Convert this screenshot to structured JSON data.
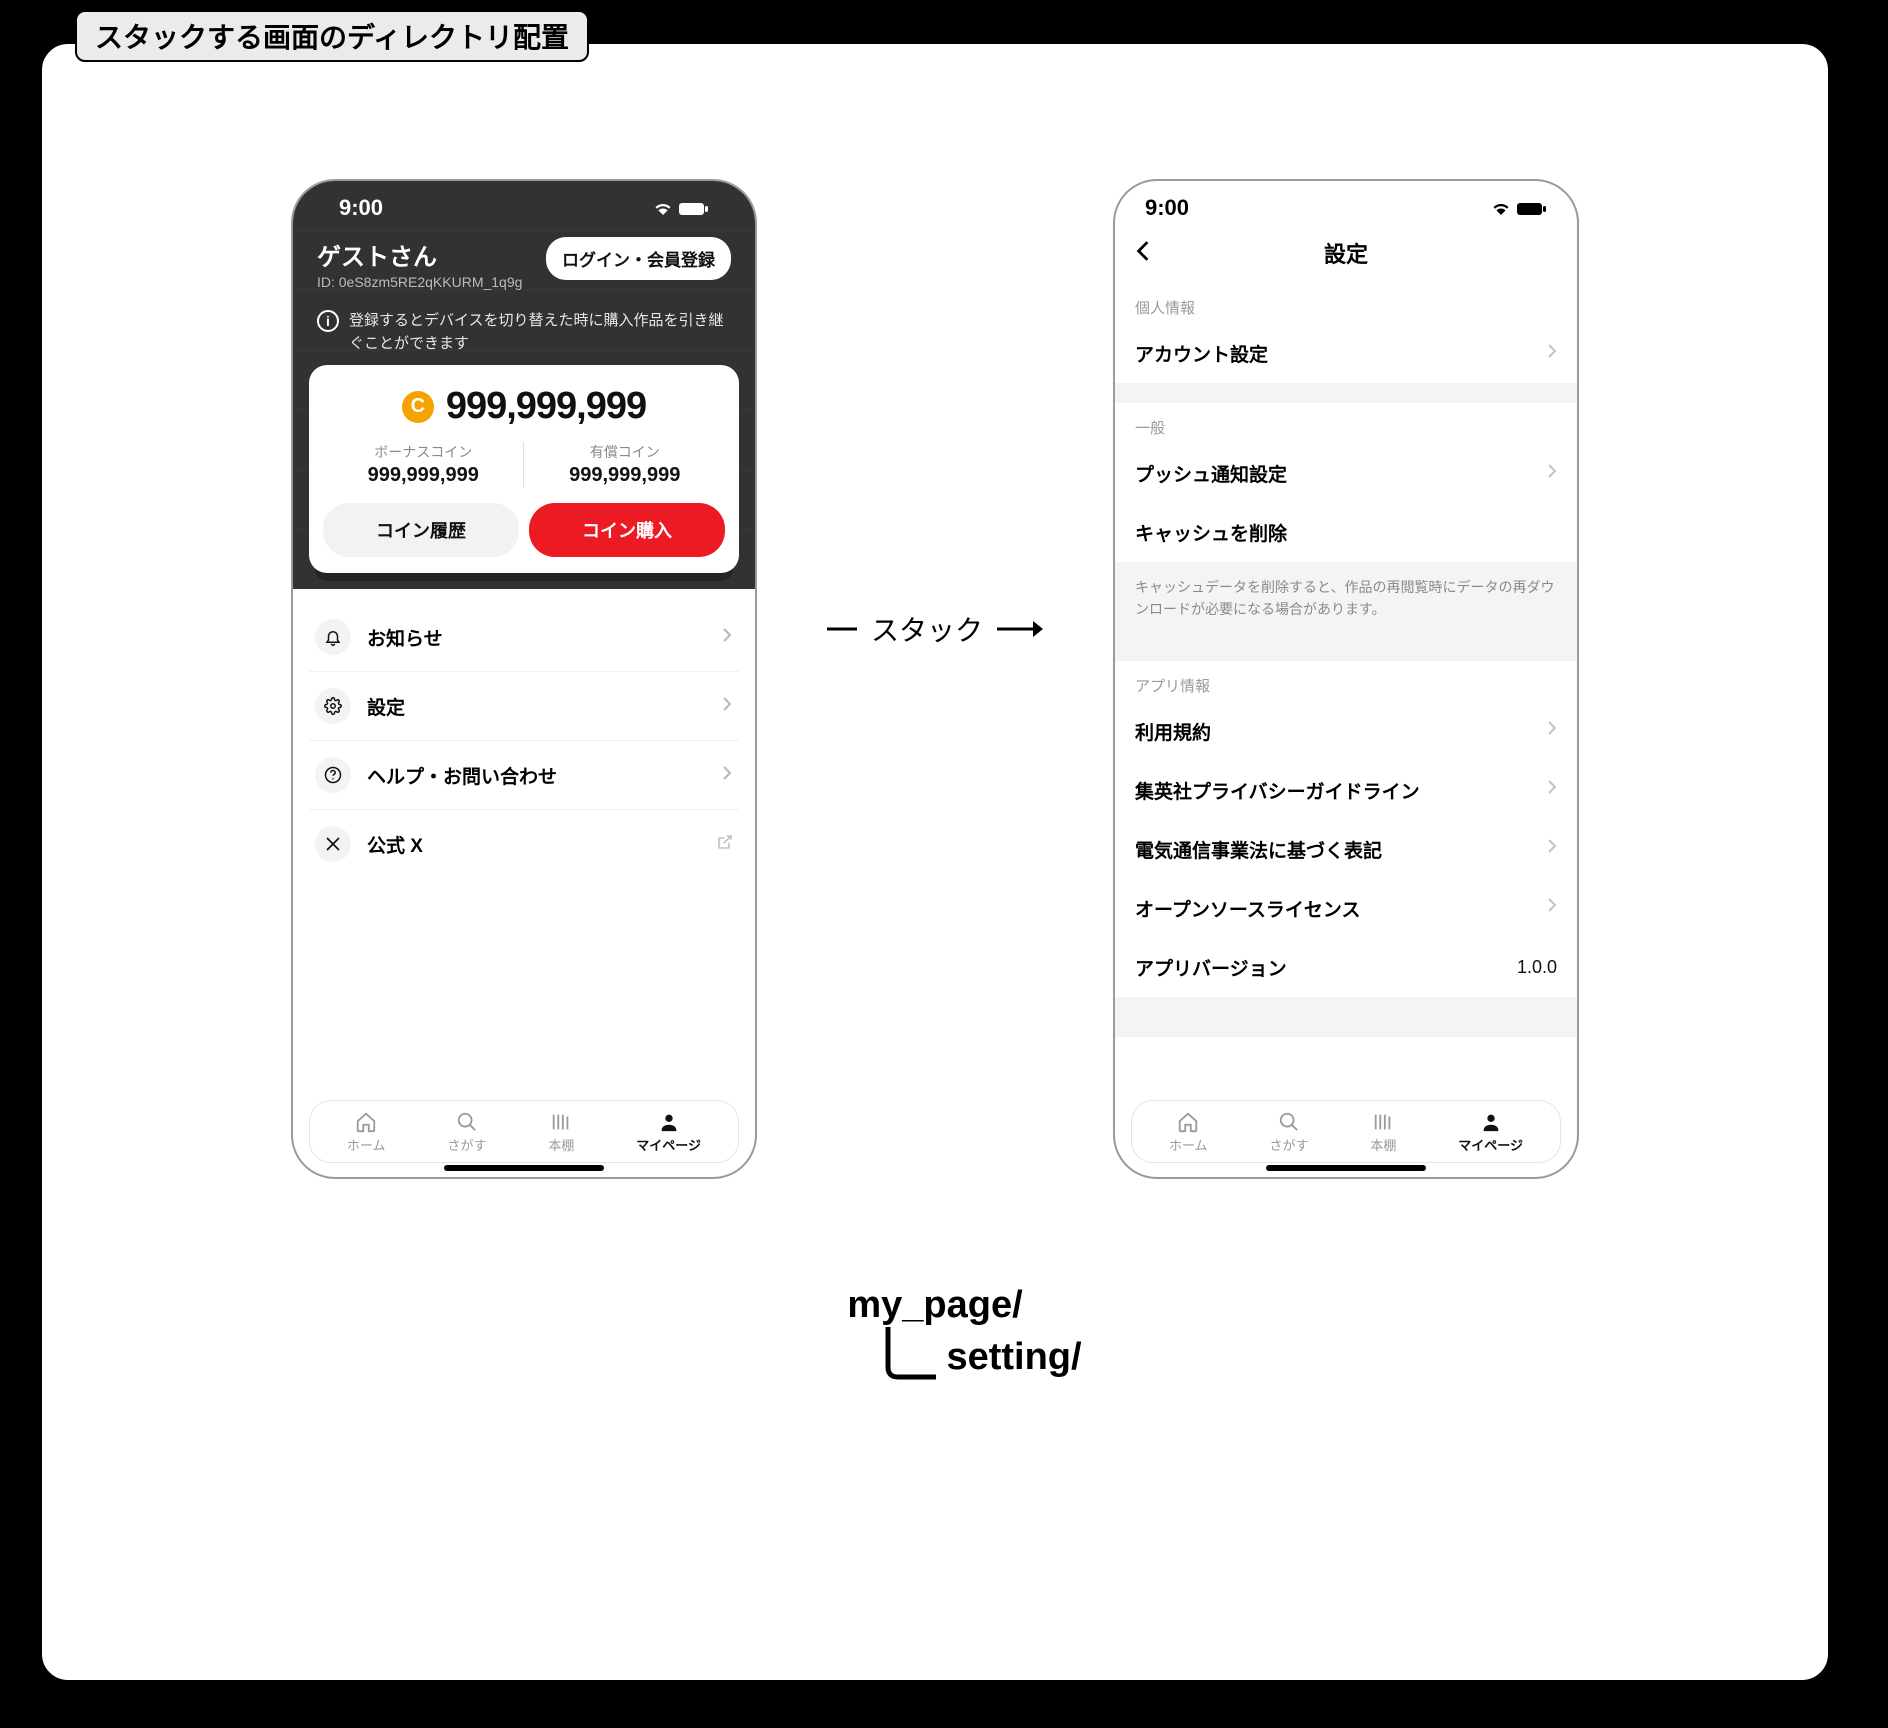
{
  "tag_label": "スタックする画面のディレクトリ配置",
  "status": {
    "time": "9:00"
  },
  "mypage": {
    "guest_name": "ゲストさん",
    "guest_id": "ID: 0eS8zm5RE2qKKURM_1q9g",
    "login_button": "ログイン・会員登録",
    "info_text": "登録するとデバイスを切り替えた時に購入作品を引き継ぐことができます",
    "coins": {
      "total": "999,999,999",
      "bonus_label": "ボーナスコイン",
      "bonus_value": "999,999,999",
      "paid_label": "有償コイン",
      "paid_value": "999,999,999",
      "history_btn": "コイン履歴",
      "buy_btn": "コイン購入"
    },
    "menu": {
      "notice": "お知らせ",
      "settings": "設定",
      "help": "ヘルプ・お問い合わせ",
      "x": "公式 X"
    }
  },
  "settings": {
    "title": "設定",
    "sec_personal": "個人情報",
    "account": "アカウント設定",
    "sec_general": "一般",
    "push": "プッシュ通知設定",
    "clear_cache": "キャッシュを削除",
    "cache_note": "キャッシュデータを削除すると、作品の再閲覧時にデータの再ダウンロードが必要になる場合があります。",
    "sec_app": "アプリ情報",
    "terms": "利用規約",
    "privacy": "集英社プライバシーガイドライン",
    "telecom": "電気通信事業法に基づく表記",
    "oss": "オープンソースライセンス",
    "version_label": "アプリバージョン",
    "version_value": "1.0.0"
  },
  "tabs": {
    "home": "ホーム",
    "search": "さがす",
    "shelf": "本棚",
    "mypage": "マイページ"
  },
  "arrow_label": "スタック",
  "dir": {
    "line1": "my_page/",
    "line2": "setting/"
  }
}
